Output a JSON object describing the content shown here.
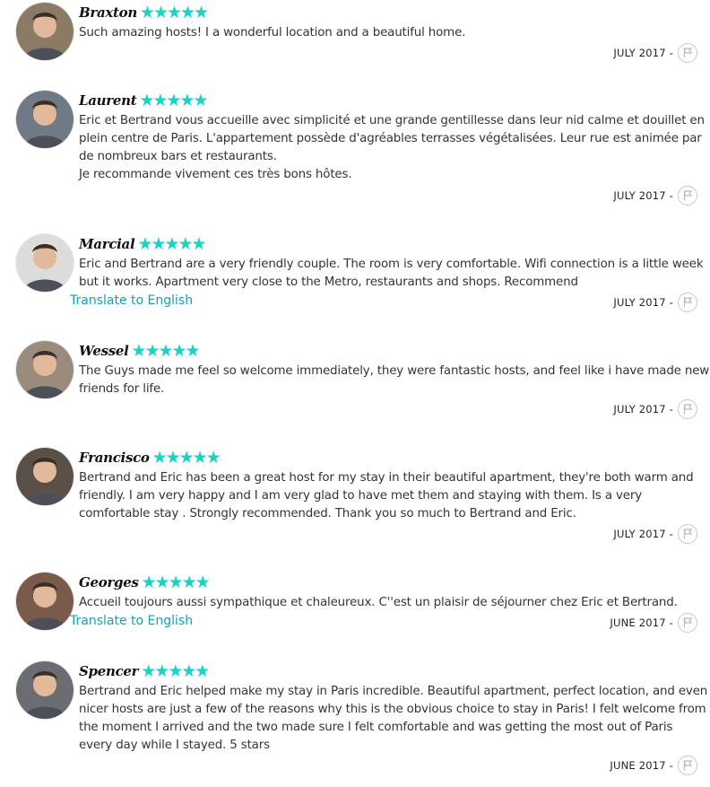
{
  "reviews": [
    {
      "name": "Braxton",
      "stars": "★★★★★",
      "lines": [
        "Such amazing hosts! I a wonderful location and a beautiful home."
      ],
      "translate": "",
      "date": "JULY 2017 -",
      "avatar_icon": "person-avatar-icon",
      "avatar_bg": "#8a7a66"
    },
    {
      "name": "Laurent",
      "stars": "★★★★★",
      "lines": [
        "Eric et Bertrand vous accueille avec simplicité et une grande gentillesse dans leur nid calme et douillet en",
        "plein centre de Paris. L'appartement possède d'agréables terrasses végétalisées. Leur rue est animée par",
        "de nombreux bars et restaurants.",
        "Je recommande vivement ces très bons hôtes."
      ],
      "translate": "",
      "date": "JULY 2017 -",
      "avatar_icon": "person-avatar-icon",
      "avatar_bg": "#6f7a86"
    },
    {
      "name": "Marcial",
      "stars": "★★★★★",
      "lines": [
        "Eric and Bertrand are a very friendly couple. The room is very comfortable. Wifi connection is a little week",
        "but it works. Apartment very close to the Metro, restaurants and shops. Recommend"
      ],
      "translate": "Translate to English",
      "date": "JULY 2017 -",
      "avatar_icon": "person-avatar-icon",
      "avatar_bg": "#dcdcdc"
    },
    {
      "name": "Wessel",
      "stars": "★★★★★",
      "lines": [
        "The Guys made me feel so welcome immediately, they were fantastic hosts, and feel like i have made new",
        "friends for life."
      ],
      "translate": "",
      "date": "JULY 2017 -",
      "avatar_icon": "person-avatar-icon",
      "avatar_bg": "#9a8b7c"
    },
    {
      "name": "Francisco",
      "stars": "★★★★★",
      "lines": [
        "Bertrand and Eric has been a great host for my stay in their beautiful apartment, they're both warm and",
        "friendly. I am very happy and I am very glad to have met them and staying with them. Is a very",
        "comfortable stay . Strongly recommended. Thank you so much to Bertrand and Eric."
      ],
      "translate": "",
      "date": "JULY 2017 -",
      "avatar_icon": "person-avatar-icon",
      "avatar_bg": "#5a5048"
    },
    {
      "name": "Georges",
      "stars": "★★★★★",
      "lines": [
        "Accueil toujours aussi sympathique et chaleureux. C''est un plaisir de séjourner chez Eric et Bertrand."
      ],
      "translate": "Translate to English",
      "date": "JUNE 2017 -",
      "avatar_icon": "person-avatar-icon",
      "avatar_bg": "#7a5a4a"
    },
    {
      "name": "Spencer",
      "stars": "★★★★★",
      "lines": [
        "Bertrand and Eric helped make my stay in Paris incredible. Beautiful apartment, perfect location, and even",
        "nicer hosts are just a few of the reasons why this is the obvious choice to stay in Paris! I felt welcome from",
        "the moment I arrived and the two made sure I felt comfortable and was getting the most out of Paris",
        "every day while I stayed. 5 stars"
      ],
      "translate": "",
      "date": "JUNE 2017 -",
      "avatar_icon": "person-avatar-icon",
      "avatar_bg": "#6a6e72"
    }
  ],
  "colors": {
    "star": "#19d3c5",
    "link": "#15a0b3",
    "text": "#333333",
    "flag_border": "#c8c8c8"
  },
  "flag_icon": "flag-icon"
}
